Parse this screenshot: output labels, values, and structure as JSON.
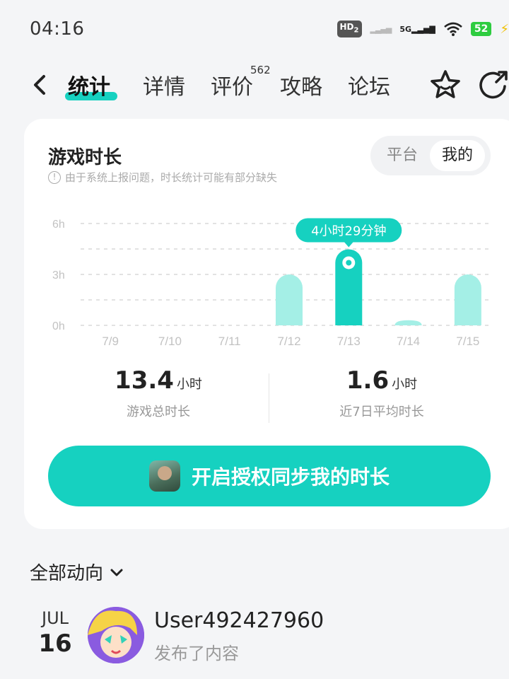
{
  "status_bar": {
    "time": "04:16",
    "hd_label": "HD",
    "hd_sub": "2",
    "network_label": "5G",
    "battery": "52"
  },
  "nav": {
    "tabs": [
      {
        "label": "统计",
        "active": true
      },
      {
        "label": "详情"
      },
      {
        "label": "评价"
      },
      {
        "label": "攻略"
      },
      {
        "label": "论坛"
      }
    ],
    "review_count": "562"
  },
  "card": {
    "title": "游戏时长",
    "note": "由于系统上报问题，时长统计可能有部分缺失",
    "toggle": {
      "options": [
        "平台",
        "我的"
      ],
      "selected": "我的"
    }
  },
  "chart_data": {
    "type": "bar",
    "categories": [
      "7/9",
      "7/10",
      "7/11",
      "7/12",
      "7/13",
      "7/14",
      "7/15"
    ],
    "values": [
      0,
      0,
      0,
      3.0,
      4.48,
      0.3,
      3.0
    ],
    "y_ticks": [
      "0h",
      "3h",
      "6h"
    ],
    "ylim": [
      0,
      6
    ],
    "highlight_index": 4,
    "highlight_label": "4小时29分钟",
    "grid": true,
    "colors": {
      "bar": "#a4efe6",
      "highlight": "#16d1c0"
    }
  },
  "stats": {
    "total": {
      "value": "13.4",
      "unit": "小时",
      "label": "游戏总时长"
    },
    "avg": {
      "value": "1.6",
      "unit": "小时",
      "label": "近7日平均时长"
    }
  },
  "sync_button": {
    "label": "开启授权同步我的时长"
  },
  "feed": {
    "header": "全部动向",
    "post": {
      "month": "JUL",
      "day": "16",
      "user": "User492427960",
      "action": "发布了内容"
    }
  },
  "colors": {
    "accent": "#16d1c0"
  }
}
